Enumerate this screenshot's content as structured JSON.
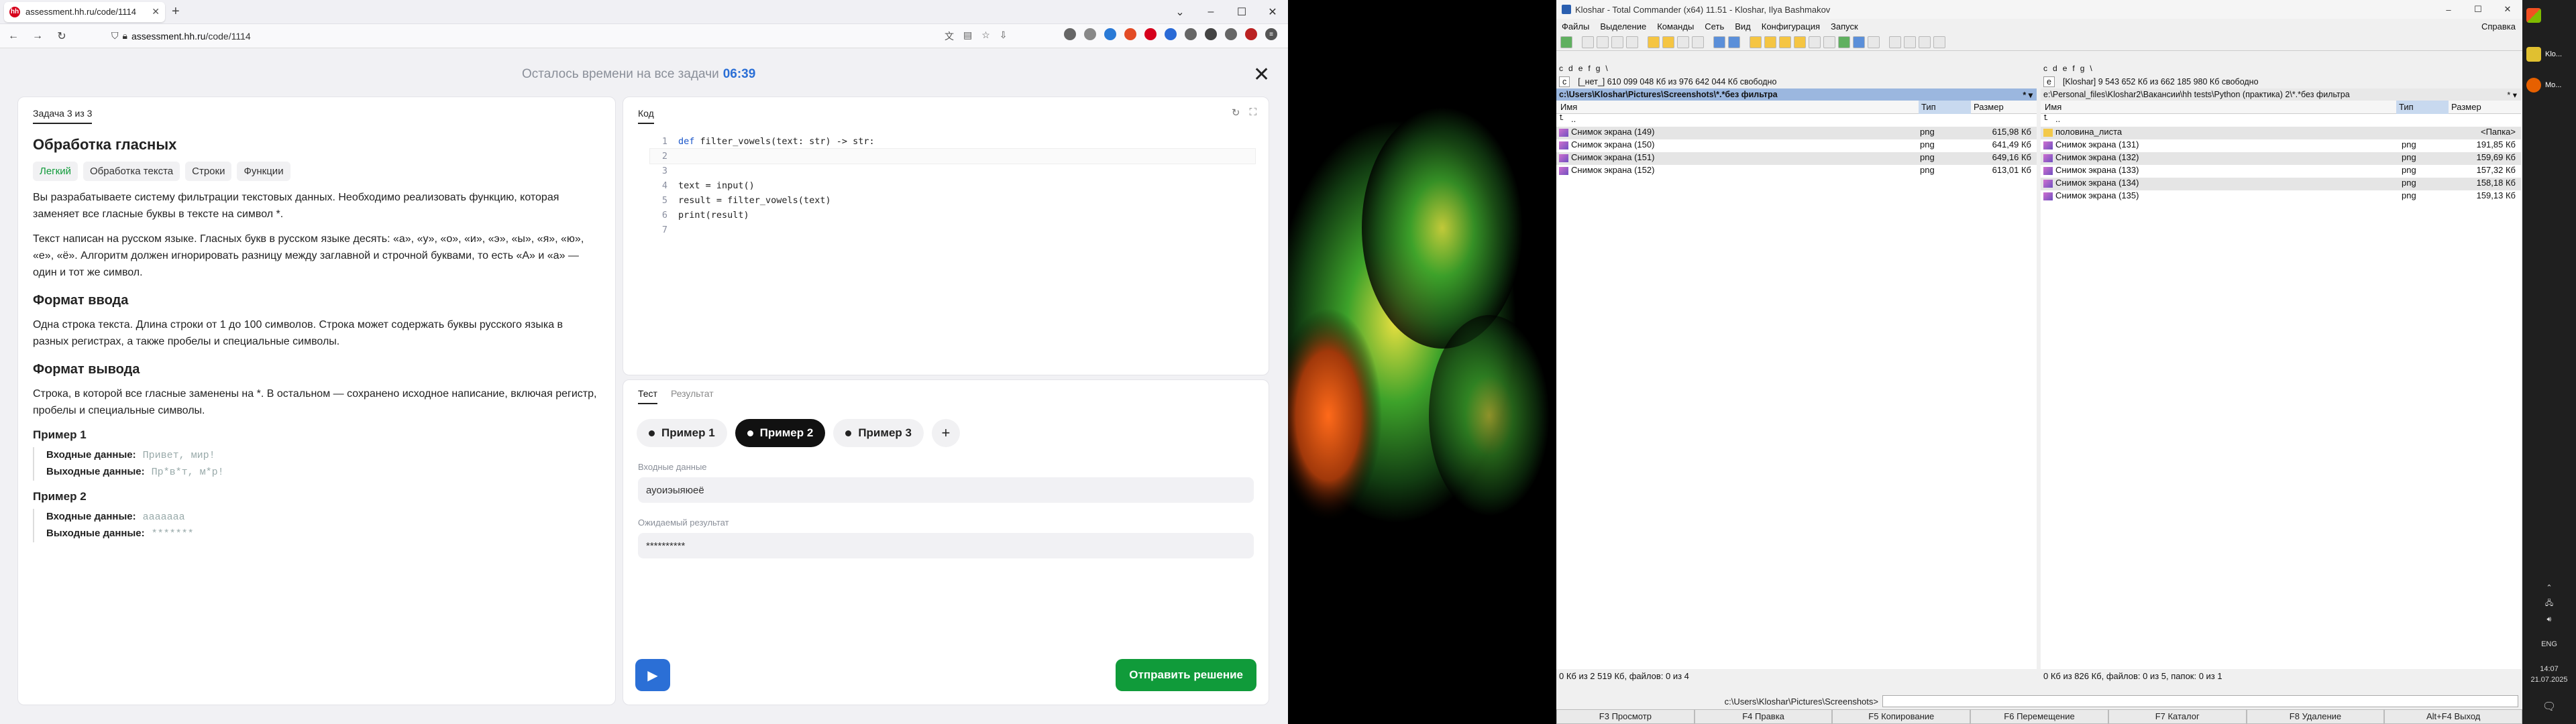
{
  "browser": {
    "tab_title": "assessment.hh.ru/code/1114",
    "tab_favicon": "hh",
    "url_host": "assessment.hh.ru",
    "url_path": "/code/1114"
  },
  "timer": {
    "label": "Осталось времени на все задачи",
    "value": "06:39"
  },
  "task": {
    "counter": "Задача 3 из 3",
    "title": "Обработка гласных",
    "tags": [
      "Легкий",
      "Обработка текста",
      "Строки",
      "Функции"
    ],
    "p1": "Вы разрабатываете систему фильтрации текстовых данных. Необходимо реализовать функцию, которая заменяет все гласные буквы в тексте на символ *.",
    "p2": "Текст написан на русском языке. Гласных букв в русском языке десять: «а», «у», «о», «и», «э», «ы», «я», «ю», «е», «ё». Алгоритм должен игнорировать разницу между заглавной и строчной буквами, то есть «А» и «а» — один и тот же символ.",
    "input_title": "Формат ввода",
    "input_text": "Одна строка текста. Длина строки от 1 до 100 символов. Строка может содержать буквы русского языка в разных регистрах, а также пробелы и специальные символы.",
    "output_title": "Формат вывода",
    "output_text": "Строка, в которой все гласные заменены на *. В остальном — сохранено исходное написание, включая регистр, пробелы и специальные символы.",
    "ex1_title": "Пример 1",
    "ex1_in_label": "Входные данные:",
    "ex1_in": "Привет, мир!",
    "ex1_out_label": "Выходные данные:",
    "ex1_out": "Пр*в*т, м*р!",
    "ex2_title": "Пример 2",
    "ex2_in_label": "Входные данные:",
    "ex2_in": "ааааааа",
    "ex2_out_label": "Выходные данные:",
    "ex2_out": "*******"
  },
  "code": {
    "tab": "Код",
    "lines": [
      {
        "n": "1",
        "text": "def filter_vowels(text: str) -> str:"
      },
      {
        "n": "2",
        "text": ""
      },
      {
        "n": "3",
        "text": ""
      },
      {
        "n": "4",
        "text": "text = input()"
      },
      {
        "n": "5",
        "text": "result = filter_vowels(text)"
      },
      {
        "n": "6",
        "text": "print(result)"
      },
      {
        "n": "7",
        "text": ""
      }
    ]
  },
  "test": {
    "tab_test": "Тест",
    "tab_result": "Результат",
    "examples": [
      "Пример 1",
      "Пример 2",
      "Пример 3"
    ],
    "selected_example": "Пример 2",
    "input_label": "Входные данные",
    "input_value": "ауоиэыяюеё",
    "expected_label": "Ожидаемый результат",
    "expected_value": "**********",
    "submit": "Отправить решение"
  },
  "tc": {
    "title": "Kloshar - Total Commander (x64) 11.51 - Kloshar, Ilya Bashmakov",
    "menu": [
      "Файлы",
      "Выделение",
      "Команды",
      "Сеть",
      "Вид",
      "Конфигурация",
      "Запуск"
    ],
    "help": "Справка",
    "left": {
      "drive": "c",
      "drive_info": "[_нет_]  610 099 048 Кб из 976 642 044 Кб свободно",
      "path": "c:\\Users\\Kloshar\\Pictures\\Screenshots\\*.*без фильтра",
      "col_name": "Имя",
      "col_type": "Тип",
      "col_size": "Размер",
      "up": "..",
      "files": [
        {
          "name": "Снимок экрана (149)",
          "ext": "png",
          "size": "615,98 Кб"
        },
        {
          "name": "Снимок экрана (150)",
          "ext": "png",
          "size": "641,49 Кб"
        },
        {
          "name": "Снимок экрана (151)",
          "ext": "png",
          "size": "649,16 Кб"
        },
        {
          "name": "Снимок экрана (152)",
          "ext": "png",
          "size": "613,01 Кб"
        }
      ],
      "status": "0 Кб из 2 519 Кб, файлов: 0 из 4"
    },
    "right": {
      "drive": "e",
      "drive_info": "[Kloshar]  9 543 652 Кб из 662 185 980 Кб свободно",
      "path": "e:\\Personal_files\\Kloshar2\\Вакансии\\hh tests\\Python (практика) 2\\*.*без фильтра",
      "col_name": "Имя",
      "col_type": "Тип",
      "col_size": "Размер",
      "up": "..",
      "folder": {
        "name": "половина_листа",
        "size": "<Папка>"
      },
      "files": [
        {
          "name": "Снимок экрана (131)",
          "ext": "png",
          "size": "191,85 Кб"
        },
        {
          "name": "Снимок экрана (132)",
          "ext": "png",
          "size": "159,69 Кб"
        },
        {
          "name": "Снимок экрана (133)",
          "ext": "png",
          "size": "157,32 Кб"
        },
        {
          "name": "Снимок экрана (134)",
          "ext": "png",
          "size": "158,18 Кб"
        },
        {
          "name": "Снимок экрана (135)",
          "ext": "png",
          "size": "159,13 Кб"
        }
      ],
      "status": "0 Кб из 826 Кб, файлов: 0 из 5, папок: 0 из 1"
    },
    "cmd_path": "c:\\Users\\Kloshar\\Pictures\\Screenshots>",
    "fkeys": [
      "F3 Просмотр",
      "F4 Правка",
      "F5 Копирование",
      "F6 Перемещение",
      "F7 Каталог",
      "F8 Удаление",
      "Alt+F4 Выход"
    ]
  },
  "taskbar": {
    "items": [
      "Klo...",
      "Mo..."
    ],
    "lang": "ENG",
    "time": "14:07",
    "date": "21.07.2025"
  }
}
